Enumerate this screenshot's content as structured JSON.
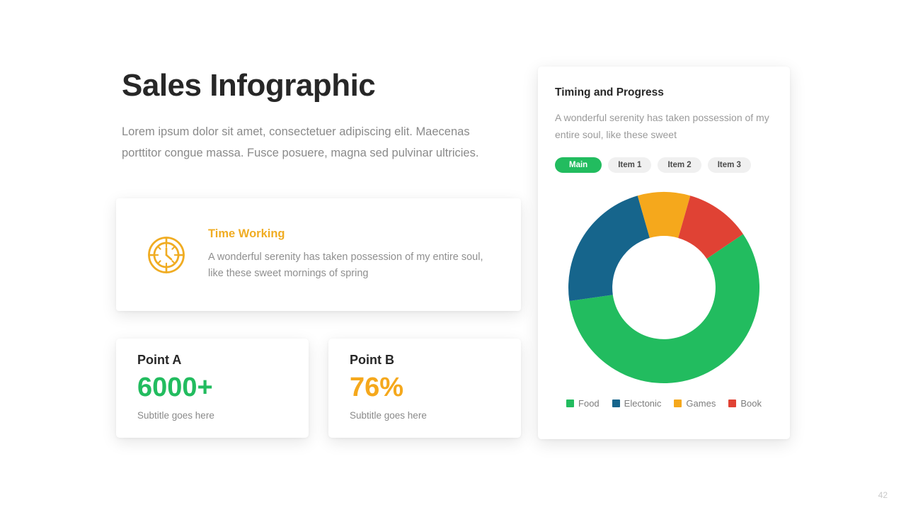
{
  "slide": {
    "title": "Sales Infographic",
    "description": "Lorem ipsum dolor sit amet, consectetuer adipiscing elit. Maecenas porttitor congue massa. Fusce posuere, magna sed pulvinar ultricies.",
    "page_number": "42"
  },
  "feature_card": {
    "icon": "clock-icon",
    "title": "Time Working",
    "text": "A wonderful serenity has taken possession of my entire soul, like these sweet mornings of spring",
    "title_color": "#f0ac22"
  },
  "stats": [
    {
      "label": "Point A",
      "value": "6000+",
      "subtitle": "Subtitle goes here",
      "value_color": "#22bc5f"
    },
    {
      "label": "Point B",
      "value": "76%",
      "subtitle": "Subtitle goes here",
      "value_color": "#f5a81c"
    }
  ],
  "panel": {
    "title": "Timing and Progress",
    "description": "A wonderful serenity has taken possession of my entire soul, like these sweet",
    "tabs": [
      {
        "label": "Main",
        "active": true
      },
      {
        "label": "Item 1",
        "active": false
      },
      {
        "label": "Item 2",
        "active": false
      },
      {
        "label": "Item 3",
        "active": false
      }
    ],
    "active_tab_color": "#22bc5f"
  },
  "chart_data": {
    "type": "pie",
    "variant": "donut",
    "title": "",
    "labels": [
      "Food",
      "Electonic",
      "Games",
      "Book"
    ],
    "values": [
      57.2,
      22.8,
      8.9,
      11.1
    ],
    "colors": [
      "#22bc5f",
      "#16658c",
      "#f5a81c",
      "#e04234"
    ],
    "start_angle_deg": 56,
    "legend_position": "bottom",
    "inner_radius_ratio": 0.54,
    "segments": [
      {
        "label": "Food",
        "value": 57.2,
        "color": "#22bc5f",
        "start_deg": 56,
        "end_deg": 262
      },
      {
        "label": "Electonic",
        "value": 22.8,
        "color": "#16658c",
        "start_deg": 262,
        "end_deg": 344
      },
      {
        "label": "Games",
        "value": 8.9,
        "color": "#f5a81c",
        "start_deg": 344,
        "end_deg": 376
      },
      {
        "label": "Book",
        "value": 11.1,
        "color": "#e04234",
        "start_deg": 16,
        "end_deg": 56
      }
    ]
  }
}
